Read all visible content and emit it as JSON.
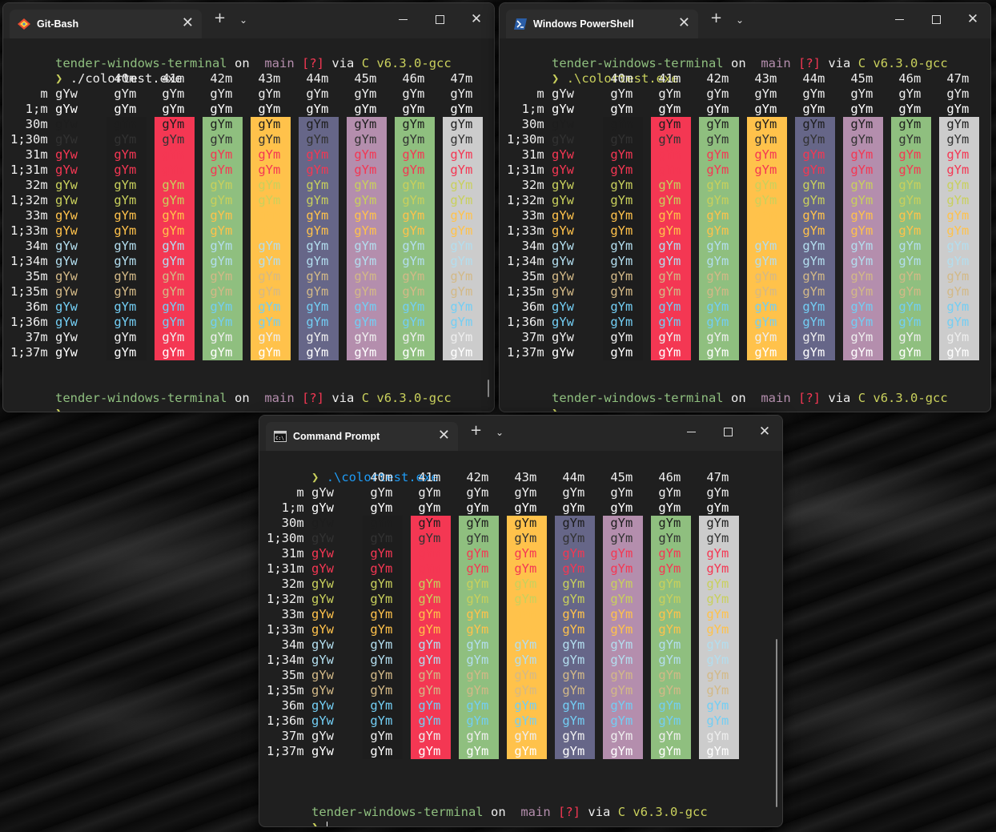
{
  "theme": {
    "fg": [
      "#1d1d1d",
      "#f43753",
      "#c9d05c",
      "#ffc24b",
      "#b3deef",
      "#d3b987",
      "#73cef4",
      "#eeeeee"
    ],
    "fg_bright": [
      "#323232",
      "#f43753",
      "#c9d05c",
      "#ffc24b",
      "#b3deef",
      "#d3b987",
      "#73cef4",
      "#ffffff"
    ],
    "bg": [
      "#1d1d1d",
      "#f43753",
      "#8fbf7f",
      "#ffc24b",
      "#666688",
      "#b48ead",
      "#8fbf7f",
      "#cccccc"
    ]
  },
  "colortest": {
    "col_headers": [
      "40m",
      "41m",
      "42m",
      "43m",
      "44m",
      "45m",
      "46m",
      "47m"
    ],
    "row_labels": [
      "m",
      "1;m",
      "30m",
      "1;30m",
      "31m",
      "1;31m",
      "32m",
      "1;32m",
      "33m",
      "1;33m",
      "34m",
      "1;34m",
      "35m",
      "1;35m",
      "36m",
      "1;36m",
      "37m",
      "1;37m"
    ],
    "row_text": "gYw",
    "cell_text": "gYm"
  },
  "prompt": {
    "dir": "tender-windows-terminal",
    "on": "on",
    "branch_icon": "",
    "branch": "main",
    "status": "[?]",
    "via": "via",
    "lang_icon": "C",
    "version": "v6.3.0-gcc",
    "symbol": "❯"
  },
  "windows": {
    "gitbash": {
      "tab_title": "Git-Bash",
      "command": "./colortest.exe"
    },
    "powershell": {
      "tab_title": "Windows PowerShell",
      "command": ".\\colortest.exe"
    },
    "cmd": {
      "tab_title": "Command Prompt",
      "command": ".\\colortest.exe"
    }
  },
  "colors": {
    "prompt_dir": "#8fbf7f",
    "prompt_branch": "#b48ead",
    "prompt_status": "#f43753",
    "prompt_lang": "#c9d05c",
    "prompt_symbol": "#c9d05c",
    "cmd_link": "#1f9bf5"
  },
  "icons": {
    "close": "✕",
    "plus": "+",
    "dropdown": "⌄"
  }
}
